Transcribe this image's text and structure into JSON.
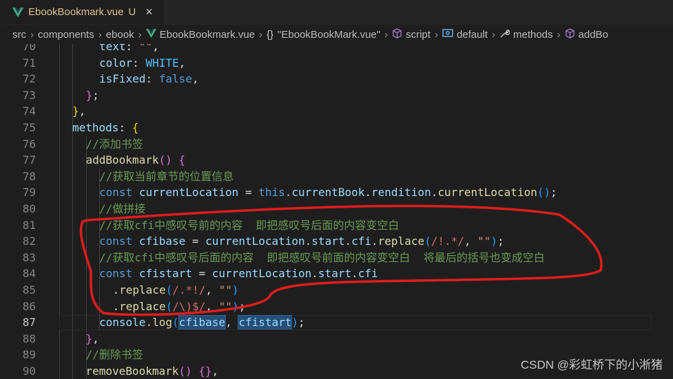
{
  "tab": {
    "title": "EbookBookmark.vue",
    "status": "U",
    "close": "×"
  },
  "breadcrumb": [
    {
      "label": "src"
    },
    {
      "label": "components"
    },
    {
      "label": "ebook"
    },
    {
      "label": "EbookBookmark.vue",
      "icon": "vue-icon"
    },
    {
      "label": "\"EbookBookMark.vue\"",
      "icon": "braces-icon",
      "icon_text": "{}"
    },
    {
      "label": "script",
      "icon": "cube-icon"
    },
    {
      "label": "default",
      "icon": "module-icon"
    },
    {
      "label": "methods",
      "icon": "wrench-icon"
    },
    {
      "label": "addBo",
      "icon": "cube-icon"
    }
  ],
  "editor": {
    "active_line": "87",
    "lines": [
      {
        "n": "70",
        "text": "text: \"\","
      },
      {
        "n": "71",
        "text": "color: WHITE,"
      },
      {
        "n": "72",
        "text": "isFixed: false,"
      },
      {
        "n": "73",
        "text": "};"
      },
      {
        "n": "74",
        "text": "},"
      },
      {
        "n": "75",
        "text": "methods: {"
      },
      {
        "n": "76",
        "text": "//添加书签"
      },
      {
        "n": "77",
        "text": "addBookmark() {"
      },
      {
        "n": "78",
        "text": "//获取当前章节的位置信息"
      },
      {
        "n": "79",
        "text": "const currentLocation = this.currentBook.rendition.currentLocation();"
      },
      {
        "n": "80",
        "text": "//做拼接"
      },
      {
        "n": "81",
        "text": "//获取cfi中感叹号前的内容  即把感叹号后面的内容变空白"
      },
      {
        "n": "82",
        "text": "const cfibase = currentLocation.start.cfi.replace(/!.*/, \"\");"
      },
      {
        "n": "83",
        "text": "//获取cfi中感叹号后面的内容  即把感叹号前面的内容变空白  将最后的括号也变成空白"
      },
      {
        "n": "84",
        "text": "const cfistart = currentLocation.start.cfi"
      },
      {
        "n": "85",
        "text": ".replace(/.*!/, \"\")"
      },
      {
        "n": "86",
        "text": ".replace(/\\)$/, \"\");"
      },
      {
        "n": "87",
        "text": "console.log(cfibase, cfistart);"
      },
      {
        "n": "88",
        "text": "},"
      },
      {
        "n": "89",
        "text": "//删除书签"
      },
      {
        "n": "90",
        "text": "removeBookmark() {},"
      }
    ]
  },
  "watermark": "CSDN @彩虹桥下的小淅猪",
  "colors": {
    "background": "#1e1e1e",
    "keyword": "#569cd6",
    "function": "#dcdcaa",
    "variable": "#9cdcfe",
    "string": "#ce9178",
    "regex": "#d16969",
    "comment": "#6a9955",
    "annotation": "#e11d1d"
  }
}
